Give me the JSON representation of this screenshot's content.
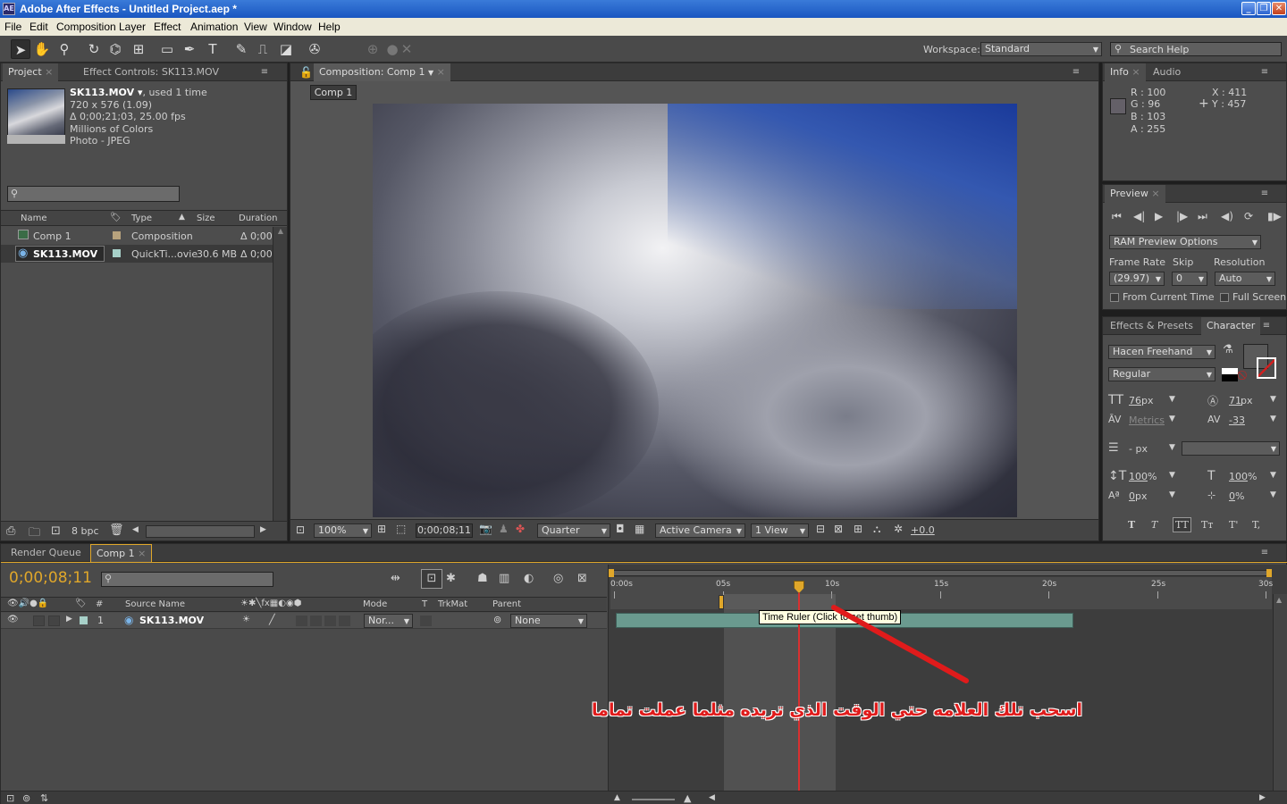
{
  "window": {
    "title": "Adobe After Effects - Untitled Project.aep *",
    "app_icon": "AE"
  },
  "menu": [
    "File",
    "Edit",
    "Composition",
    "Layer",
    "Effect",
    "Animation",
    "View",
    "Window",
    "Help"
  ],
  "toolbar": {
    "workspace_label": "Workspace:",
    "workspace_value": "Standard",
    "search_placeholder": "Search Help"
  },
  "project_panel": {
    "tabs": [
      "Project",
      "Effect Controls: SK113.MOV"
    ],
    "footage": {
      "name": "SK113.MOV",
      "used": ", used 1 time",
      "dims": "720 x 576 (1.09)",
      "duration": "Δ 0;00;21;03, 25.00 fps",
      "colors": "Millions of Colors",
      "codec": "Photo - JPEG"
    },
    "columns": [
      "Name",
      "Type",
      "Size",
      "Duration"
    ],
    "rows": [
      {
        "name": "Comp 1",
        "type": "Composition",
        "size": "",
        "duration": "Δ 0;00;"
      },
      {
        "name": "SK113.MOV",
        "type": "QuickTi...ovie",
        "size": "30.6 MB",
        "duration": "Δ 0;00;"
      }
    ],
    "bpc": "8 bpc"
  },
  "composition_panel": {
    "tab": "Composition: Comp 1",
    "comp_button": "Comp 1",
    "zoom": "100%",
    "timecode": "0;00;08;11",
    "resolution": "Quarter",
    "camera": "Active Camera",
    "views": "1 View",
    "exposure": "+0.0"
  },
  "info_panel": {
    "tabs": [
      "Info",
      "Audio"
    ],
    "r": "R : 100",
    "g": "G : 96",
    "b": "B : 103",
    "a": "A : 255",
    "x": "X : 411",
    "y": "Y : 457"
  },
  "preview_panel": {
    "tab": "Preview",
    "ram_options": "RAM Preview Options",
    "frame_rate_label": "Frame Rate",
    "skip_label": "Skip",
    "resolution_label": "Resolution",
    "frame_rate": "(29.97)",
    "skip": "0",
    "resolution": "Auto",
    "from_current": "From Current Time",
    "full_screen": "Full Screen"
  },
  "character_panel": {
    "tabs": [
      "Effects & Presets",
      "Character"
    ],
    "font": "Hacen Freehand",
    "style": "Regular",
    "size": "76",
    "size_unit": "px",
    "leading": "71",
    "leading_unit": "px",
    "kerning": "Metrics",
    "tracking": "-33",
    "stroke": "- px",
    "vscale": "100",
    "vscale_unit": "%",
    "hscale": "100",
    "hscale_unit": "%",
    "baseline": "0",
    "baseline_unit": "px",
    "tsume": "0",
    "tsume_unit": "%",
    "style_buttons": [
      "T",
      "T",
      "TT",
      "Tт",
      "T'",
      "T,"
    ]
  },
  "timeline": {
    "tabs": [
      "Render Queue",
      "Comp 1"
    ],
    "timecode": "0;00;08;11",
    "columns": {
      "num": "#",
      "source": "Source Name",
      "mode": "Mode",
      "t": "T",
      "trkmat": "TrkMat",
      "parent": "Parent"
    },
    "layer": {
      "index": "1",
      "name": "SK113.MOV",
      "mode": "Nor...",
      "parent": "None"
    },
    "ruler_labels": [
      "0:00s",
      "05s",
      "10s",
      "15s",
      "20s",
      "25s",
      "30s"
    ],
    "tooltip": "Time Ruler (Click to set thumb)",
    "annotation": "اسحب تلك العلامه حتي الوقت الذي تريده مثلما عملت تماما",
    "current_time_fraction": 0.28
  },
  "colors": {
    "accent": "#e0a72a",
    "annotation": "#e01b1b",
    "layer_bar": "#6a9a8f",
    "playhead": "#d83030"
  }
}
